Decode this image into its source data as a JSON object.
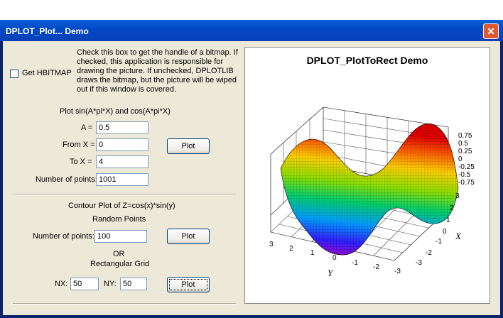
{
  "window": {
    "title": "DPLOT_Plot... Demo",
    "close_glyph": "✕"
  },
  "hbitmap": {
    "checkbox_label": "Get HBITMAP",
    "checked": false,
    "description_lines": [
      "Check this box to get the handle of a bitmap. If",
      "checked, this application is responsible for",
      "drawing the picture. If unchecked, DPLOTLIB",
      "draws the bitmap, but the picture will be wiped",
      "out if this window is covered."
    ]
  },
  "sin_section": {
    "heading": "Plot sin(A*pi*X) and cos(A*pi*X)",
    "a_label": "A =",
    "a_value": "0.5",
    "from_label": "From X =",
    "from_value": "0",
    "to_label": "To X =",
    "to_value": "4",
    "points_label": "Number of points:",
    "points_value": "1001",
    "plot_button": "Plot"
  },
  "contour_section": {
    "heading": "Contour Plot of Z=cos(x)*sin(y)",
    "random_heading": "Random Points",
    "points_label": "Number of points:",
    "points_value": "100",
    "plot_button": "Plot",
    "or_label": "OR",
    "grid_heading": "Rectangular Grid",
    "nx_label": "NX:",
    "nx_value": "50",
    "ny_label": "NY:",
    "ny_value": "50",
    "grid_plot_button": "Plot"
  },
  "plot": {
    "title": "DPLOT_PlotToRect Demo",
    "z_ticks": [
      "0.75",
      "0.5",
      "0.25",
      "0",
      "-0.25",
      "-0.5",
      "-0.75"
    ],
    "x_ticks": [
      "3",
      "2",
      "1",
      "0",
      "-1",
      "-2",
      "-3"
    ],
    "y_ticks": [
      "3",
      "2",
      "1",
      "0",
      "-1",
      "-2",
      "-3"
    ],
    "x_axis_label": "X",
    "y_axis_label": "Y"
  },
  "colors": {
    "titlebar": "#0349c6",
    "dialog_bg": "#ece9d8",
    "close_button": "#e0582f"
  }
}
